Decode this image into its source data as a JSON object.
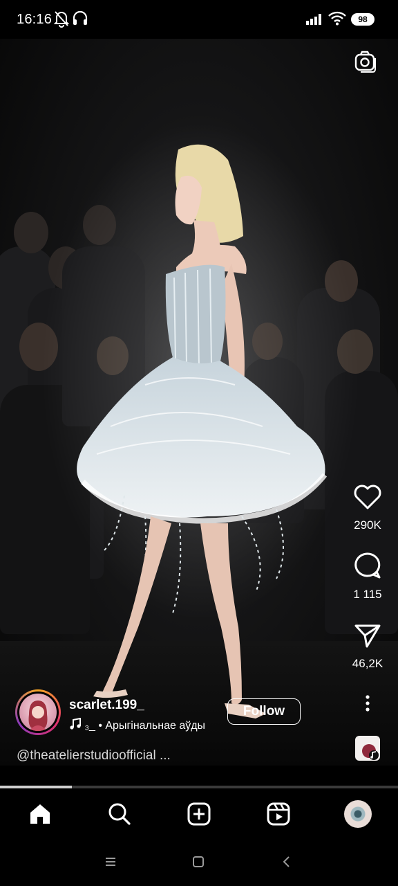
{
  "status_bar": {
    "time": "16:16",
    "battery": "98"
  },
  "reel": {
    "likes": "290K",
    "comments": "1 115",
    "shares": "46,2K",
    "progress_fraction": 0.18
  },
  "author": {
    "username": "scarlet.199_",
    "audio_prefix": "₃_ •",
    "audio_label": "Арыгінальнае аўды",
    "follow_label": "Follow"
  },
  "caption": "@theatelierstudioofficial ...",
  "nav": {
    "items": [
      "home-icon",
      "search-icon",
      "create-icon",
      "reels-icon",
      "profile-avatar"
    ]
  },
  "colors": {
    "background": "#000000",
    "accent_ring_start": "#f5a623",
    "accent_ring_end": "#8a3ab9"
  }
}
